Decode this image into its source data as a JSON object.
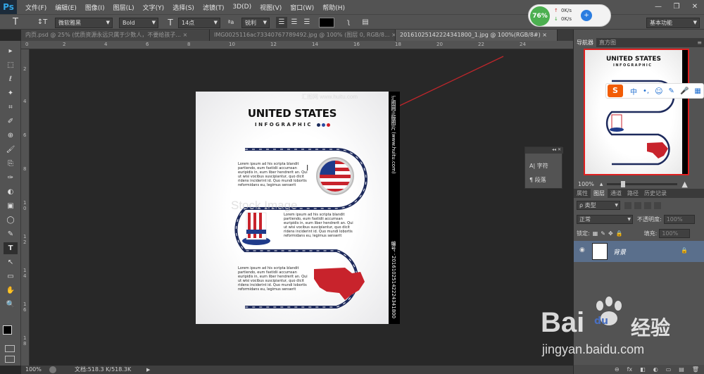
{
  "app": {
    "logo": "Ps"
  },
  "menu": [
    "文件(F)",
    "编辑(E)",
    "图像(I)",
    "图层(L)",
    "文字(Y)",
    "选择(S)",
    "滤镜(T)",
    "3D(D)",
    "视图(V)",
    "窗口(W)",
    "帮助(H)"
  ],
  "window_controls": [
    "—",
    "❐",
    "✕"
  ],
  "options": {
    "font_family": "微软雅黑",
    "font_style": "Bold",
    "font_size": "14点",
    "aa_label": "ªa",
    "antialias": "锐利",
    "workspace": "基本功能",
    "text_tool_glyph": "T",
    "orient_glyph": "↕T",
    "size_glyph": "T",
    "warp_glyph": "ʅ",
    "panel_glyph": "▤"
  },
  "network": {
    "percent": "76%",
    "up": "0K/s",
    "down": "0K/s"
  },
  "tabs": [
    {
      "label": "内页.psd @ 25% (优质资源永远只属于少数人，不要给孩子...",
      "close": "×"
    },
    {
      "label": "IMG0025116ac73340767789492.jpg @ 100% (图层 0, RGB/8...",
      "close": "×"
    },
    {
      "label": "20161025142224341800_1.jpg @ 100%(RGB/8#)",
      "close": "×"
    }
  ],
  "ruler_h": [
    "0",
    "2",
    "4",
    "6",
    "8",
    "10",
    "12",
    "14",
    "16",
    "18",
    "20",
    "22",
    "24"
  ],
  "ruler_v": [
    "2",
    "4",
    "6",
    "8",
    "1 0",
    "1 2",
    "1 4",
    "1 6",
    "1 8"
  ],
  "tools": [
    "▸",
    "⬚",
    "ℓ",
    "✦",
    "⌗",
    "✐",
    "⊕",
    "🖌",
    "⎘",
    "✑",
    "◐",
    "▣",
    "◯",
    "✎",
    "T",
    "↖",
    "▭",
    "✋",
    "🔍"
  ],
  "doc": {
    "title": "UNITED STATES",
    "subtitle": "INFOGRAPHIC",
    "watermark_top": "汇图网 www.huitu.com",
    "watermark_mid": "Stock Image",
    "strip_top": "汇图网正版图片 (www.huitu.com)",
    "strip_bottom": "编号：20161025142224341800",
    "lorem": "Lorem ipsum ad his scripta blandit partiendo, eum fastidii accumsan euripidis in, eum liber hendrerit an. Qui ut wisi vocibus suscipiantur, quo dicit ridens inciderint id. Quo mundi lobortis reformidans eu, legimus senserit"
  },
  "float_panel": {
    "char_label": "字符",
    "para_label": "段落",
    "collapse": "◂◂",
    "close": "✕",
    "char_glyph": "A|",
    "para_glyph": "¶"
  },
  "right_panel": {
    "nav_tabs": [
      "导航器",
      "直方图"
    ],
    "zoom": "100%",
    "layer_tabs": [
      "属性",
      "图层",
      "通道",
      "路径",
      "历史记录"
    ],
    "kind_label": "ρ 类型",
    "blend_mode": "正常",
    "opacity_label": "不透明度:",
    "opacity_value": "100%",
    "lock_label": "锁定:",
    "fill_label": "填充:",
    "fill_value": "100%",
    "layer_name": "背景",
    "bottom_icons": [
      "⊖",
      "fx",
      "◧",
      "◐",
      "▭",
      "▤",
      "🗑"
    ],
    "menu_glyph": "≡",
    "eye_glyph": "◉",
    "lock_glyph": "🔒"
  },
  "sogou": {
    "logo": "S",
    "items": [
      "中",
      "•,",
      "☺",
      "✎",
      "🎤",
      "▦"
    ]
  },
  "status": {
    "zoom": "100%",
    "doc_size": "文档:518.3 K/518.3K"
  },
  "baidu": {
    "logo": "Bai",
    "du": "du",
    "jingyan": "经验",
    "url": "jingyan.baidu.com"
  }
}
